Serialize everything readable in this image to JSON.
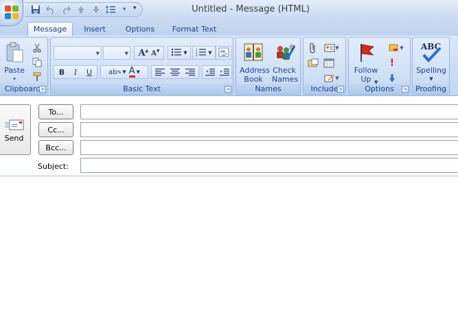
{
  "window": {
    "title": "Untitled - Message (HTML)"
  },
  "quick_access": {
    "save_icon": "save-icon",
    "undo_icon": "undo-icon",
    "redo_icon": "redo-icon",
    "previous_item_icon": "up-arrow-icon",
    "next_item_icon": "down-arrow-icon",
    "format_icon": "line-spacing-icon",
    "customize_icon": "customize-toolbar-icon"
  },
  "tabs": [
    {
      "label": "Message",
      "active": true
    },
    {
      "label": "Insert",
      "active": false
    },
    {
      "label": "Options",
      "active": false
    },
    {
      "label": "Format Text",
      "active": false
    }
  ],
  "ribbon": {
    "clipboard": {
      "label": "Clipboard",
      "paste_label": "Paste"
    },
    "basic_text": {
      "label": "Basic Text",
      "font_name": "",
      "font_size": "",
      "bold": "B",
      "italic": "I",
      "underline": "U"
    },
    "names": {
      "label": "Names",
      "address_book": "Address Book",
      "check_names": "Check Names"
    },
    "include": {
      "label": "Include"
    },
    "options": {
      "label": "Options",
      "follow_up": "Follow Up"
    },
    "proofing": {
      "label": "Proofing",
      "spelling": "Spelling",
      "abc": "ABC"
    }
  },
  "compose": {
    "send_label": "Send",
    "to_label": "To...",
    "cc_label": "Cc...",
    "bcc_label": "Bcc...",
    "subject_label": "Subject:",
    "to_value": "",
    "cc_value": "",
    "bcc_value": "",
    "subject_value": ""
  },
  "colors": {
    "ribbon_blue": "#c7daf2",
    "text_blue": "#15428b",
    "flag_red": "#d9291c"
  }
}
